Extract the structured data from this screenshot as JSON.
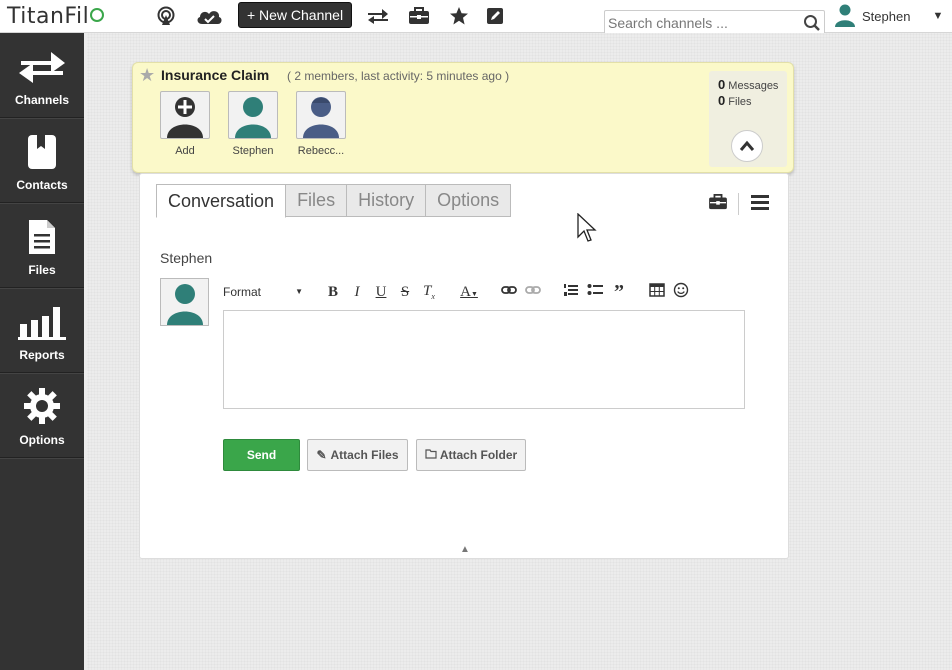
{
  "topbar": {
    "logo_text": "TitanFil",
    "new_channel_label": "+ New Channel",
    "search_placeholder": "Search channels ...",
    "user_name": "Stephen",
    "icons": [
      "radar-icon",
      "cloud-icon",
      "transfer-icon",
      "briefcase-icon",
      "star-icon",
      "edit-icon",
      "search-icon",
      "caret-down-icon"
    ]
  },
  "sidebar": {
    "items": [
      {
        "label": "Channels",
        "icon": "arrows-exchange-icon"
      },
      {
        "label": "Contacts",
        "icon": "address-book-icon"
      },
      {
        "label": "Files",
        "icon": "document-icon"
      },
      {
        "label": "Reports",
        "icon": "bar-chart-icon"
      },
      {
        "label": "Options",
        "icon": "gear-icon"
      }
    ]
  },
  "channel": {
    "title": "Insurance Claim",
    "meta": "( 2 members, last activity: 5 minutes ago )",
    "members": [
      {
        "label": "Add"
      },
      {
        "label": "Stephen"
      },
      {
        "label": "Rebecc..."
      }
    ],
    "stats": {
      "messages_count": "0",
      "messages_label": "Messages",
      "files_count": "0",
      "files_label": "Files"
    }
  },
  "tabs": [
    {
      "label": "Conversation",
      "active": true
    },
    {
      "label": "Files",
      "active": false
    },
    {
      "label": "History",
      "active": false
    },
    {
      "label": "Options",
      "active": false
    }
  ],
  "composer": {
    "author": "Stephen",
    "format_label": "Format",
    "send_label": "Send",
    "attach_files_label": "Attach Files",
    "attach_folder_label": "Attach Folder"
  },
  "colors": {
    "sidebar_bg": "#333333",
    "channel_panel_bg": "#fbf9c9",
    "send_green": "#3aa64a",
    "avatar_teal": "#2f7f78",
    "avatar_blue": "#4a5d86"
  }
}
